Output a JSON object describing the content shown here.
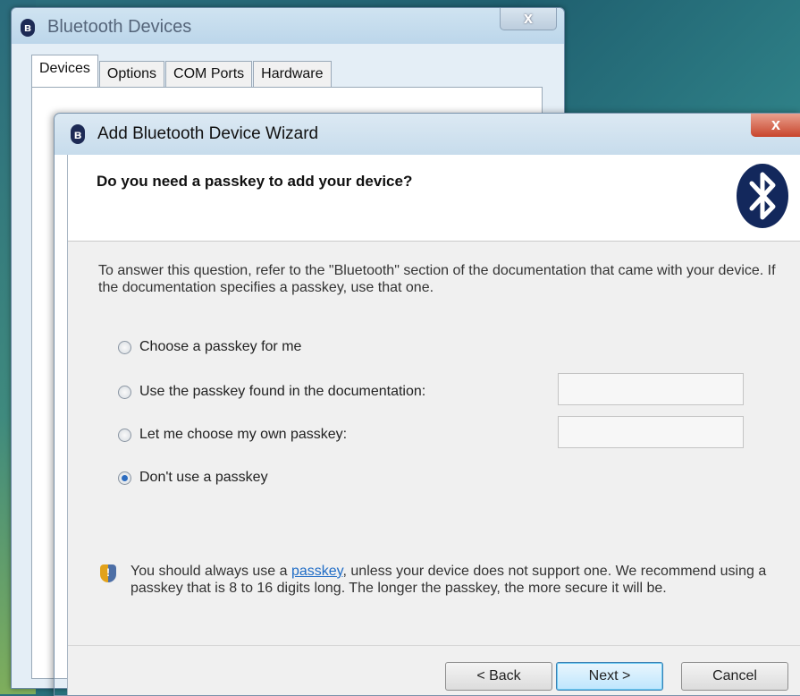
{
  "background_window": {
    "title": "Bluetooth Devices",
    "close_glyph": "x",
    "tabs": [
      "Devices",
      "Options",
      "COM Ports",
      "Hardware"
    ]
  },
  "wizard": {
    "title": "Add Bluetooth Device Wizard",
    "close_glyph": "x",
    "heading": "Do you need a passkey to add your device?",
    "intro": "To answer this question, refer to the \"Bluetooth\" section of the documentation that came with your device. If the documentation specifies a passkey, use that one.",
    "options": [
      {
        "label": "Choose a passkey for me",
        "checked": false
      },
      {
        "label": "Use the passkey found in the documentation:",
        "checked": false
      },
      {
        "label": "Let me choose my own passkey:",
        "checked": false
      },
      {
        "label": "Don't use a passkey",
        "checked": true
      }
    ],
    "passkey_doc_value": "",
    "passkey_own_value": "",
    "notice_before": "You should always use a ",
    "notice_link": "passkey",
    "notice_after": ", unless your device does not support one. We recommend using a passkey that is 8 to 16 digits long. The longer the passkey, the more secure it will be.",
    "buttons": {
      "back": "< Back",
      "next": "Next >",
      "cancel": "Cancel"
    }
  },
  "icons": {
    "bluetooth": "bluetooth-icon",
    "shield": "security-shield-icon"
  },
  "colors": {
    "link": "#1f6cc6",
    "bluetooth_logo": "#13285c",
    "close_red": "#c8452c"
  }
}
